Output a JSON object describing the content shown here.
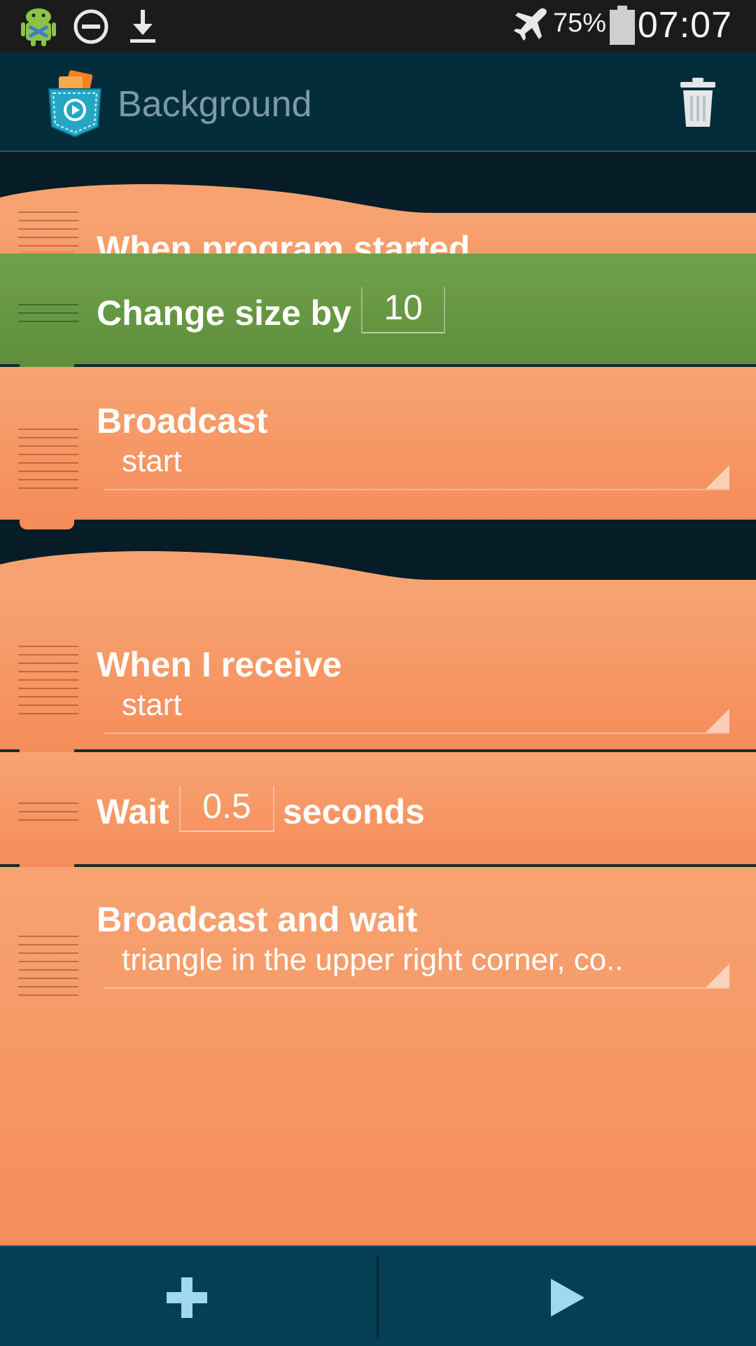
{
  "status_bar": {
    "battery_percent": "75%",
    "time": "07:07",
    "icons": [
      "android-debug-icon",
      "do-not-disturb-icon",
      "download-icon",
      "airplane-mode-icon",
      "battery-icon"
    ]
  },
  "action_bar": {
    "title": "Background",
    "icons": [
      "app-logo-icon",
      "trash-icon"
    ]
  },
  "scripts": [
    {
      "bricks": [
        {
          "type": "hat",
          "label": "When program started"
        },
        {
          "type": "change_size",
          "label": "Change size by",
          "value": "10"
        },
        {
          "type": "broadcast",
          "label": "Broadcast",
          "selected": "start"
        }
      ]
    },
    {
      "bricks": [
        {
          "type": "hat",
          "label": "When I receive",
          "selected": "start"
        },
        {
          "type": "wait",
          "label": "Wait",
          "value": "0.5",
          "suffix": "seconds"
        },
        {
          "type": "broadcast_wait",
          "label": "Broadcast and wait",
          "selected": "triangle in the upper right corner, co.."
        }
      ]
    }
  ],
  "bottom_bar": {
    "icons": [
      "add-icon",
      "play-icon"
    ]
  },
  "colors": {
    "brick_orange": "#f69966",
    "brick_green": "#67984a",
    "background": "#061c26",
    "action_bar": "#042d3c",
    "bottom_bar": "#043f55",
    "bottom_icon": "#9fd8f0"
  }
}
